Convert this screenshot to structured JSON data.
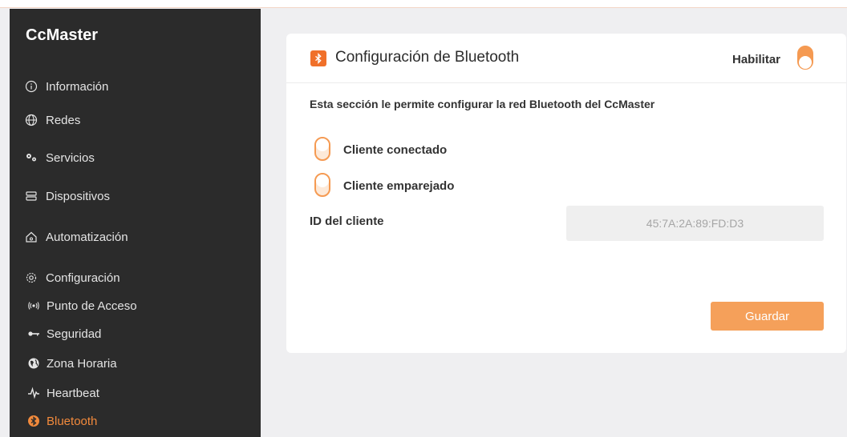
{
  "sidebar": {
    "brand": "CcMaster",
    "items": [
      {
        "label": "Información"
      },
      {
        "label": "Redes"
      },
      {
        "label": "Servicios"
      },
      {
        "label": "Dispositivos"
      },
      {
        "label": "Automatización"
      },
      {
        "label": "Configuración"
      }
    ],
    "subitems": [
      {
        "label": "Punto de Acceso"
      },
      {
        "label": "Seguridad"
      },
      {
        "label": "Zona Horaria"
      },
      {
        "label": "Heartbeat"
      },
      {
        "label": "Bluetooth",
        "active": true
      }
    ]
  },
  "card": {
    "title": "Configuración de Bluetooth",
    "enable_label": "Habilitar",
    "enabled": true,
    "description": "Esta sección le permite configurar la red Bluetooth del CcMaster",
    "toggles": [
      {
        "label": "Cliente conectado",
        "on": true
      },
      {
        "label": "Cliente emparejado",
        "on": true
      }
    ],
    "client_id_label": "ID del cliente",
    "client_id_value": "45:7A:2A:89:FD:D3",
    "save_label": "Guardar"
  },
  "colors": {
    "accent": "#f0702a",
    "button": "#f5a05a",
    "sidebar_bg": "#2b2b2b",
    "active_text": "#f28a3c"
  }
}
